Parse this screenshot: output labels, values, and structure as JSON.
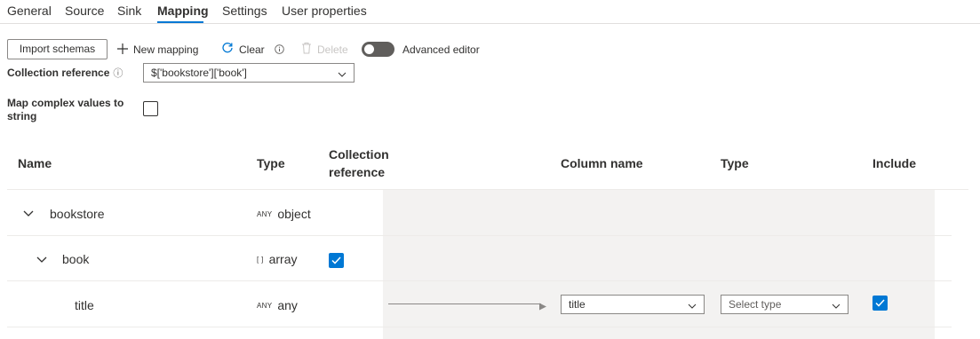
{
  "tabs": [
    {
      "label": "General"
    },
    {
      "label": "Source"
    },
    {
      "label": "Sink"
    },
    {
      "label": "Mapping",
      "active": true
    },
    {
      "label": "Settings"
    },
    {
      "label": "User properties"
    }
  ],
  "toolbar": {
    "import_schemas": "Import schemas",
    "new_mapping": "New mapping",
    "clear": "Clear",
    "delete": "Delete",
    "advanced_editor": "Advanced editor",
    "advanced_editor_on": false
  },
  "form": {
    "collection_reference_label": "Collection reference",
    "collection_reference_value": "$['bookstore']['book']",
    "map_complex_label": "Map complex values to string",
    "map_complex_checked": false
  },
  "table": {
    "headers": {
      "name": "Name",
      "type": "Type",
      "collection_reference": "Collection reference",
      "column_name": "Column name",
      "sink_type": "Type",
      "include": "Include"
    },
    "rows": [
      {
        "name": "bookstore",
        "type_badge": "ANY",
        "type": "object",
        "expanded": true
      },
      {
        "name": "book",
        "type_badge": "[ ]",
        "type": "array",
        "expanded": true,
        "collection_reference": true
      },
      {
        "name": "title",
        "type_badge": "ANY",
        "type": "any",
        "column_name": "title",
        "sink_type_placeholder": "Select type",
        "include": true
      }
    ]
  },
  "colors": {
    "accent": "#0078d4",
    "toggle_off": "#605e5c",
    "column_bg": "#f3f2f1"
  }
}
